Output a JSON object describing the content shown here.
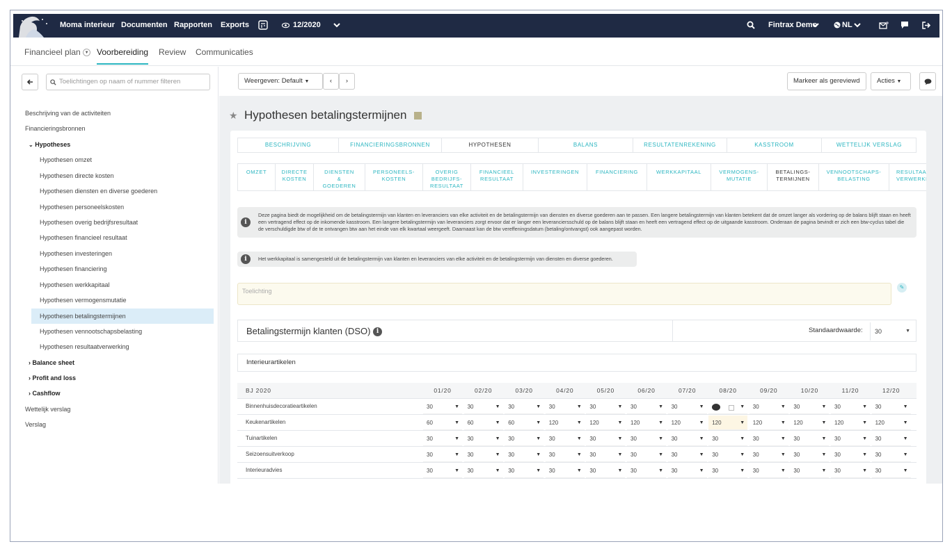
{
  "navbar": {
    "company": "Moma interieur",
    "documents": "Documenten",
    "reports": "Rapporten",
    "exports": "Exports",
    "period": "12/2020",
    "user": "Fintrax Demo",
    "language": "NL"
  },
  "subnav": {
    "tabs": [
      "Financieel plan",
      "Voorbereiding",
      "Review",
      "Communicaties"
    ]
  },
  "sidebar": {
    "filter_placeholder": "Toelichtingen op naam of nummer filteren",
    "items": [
      "Beschrijving van de activiteiten",
      "Financieringsbronnen",
      "Hypotheses",
      "Hypothesen omzet",
      "Hypothesen directe kosten",
      "Hypothesen diensten en diverse goederen",
      "Hypothesen personeelskosten",
      "Hypothesen overig bedrijfsresultaat",
      "Hypothesen financieel resultaat",
      "Hypothesen investeringen",
      "Hypothesen financiering",
      "Hypothesen werkkapitaal",
      "Hypothesen vermogensmutatie",
      "Hypothesen betalingstermijnen",
      "Hypothesen vennootschapsbelasting",
      "Hypothesen resultaatverwerking",
      "Balance sheet",
      "Profit and loss",
      "Cashflow",
      "Wettelijk verslag",
      "Verslag"
    ]
  },
  "toolbar": {
    "view": "Weergeven: Default",
    "mark_reviewed": "Markeer als gereviewd",
    "actions": "Acties"
  },
  "page": {
    "title": "Hypothesen betalingstermijnen",
    "main_tabs": [
      "BESCHRIJVING",
      "FINANCIERINGSBRONNEN",
      "HYPOTHESEN",
      "BALANS",
      "RESULTATENREKENING",
      "KASSTROOM",
      "WETTELIJK VERSLAG"
    ],
    "sub_tabs": [
      "OMZET",
      "DIRECTE\nKOSTEN",
      "DIENSTEN\n&\nGOEDEREN",
      "PERSONEELS-\nKOSTEN",
      "OVERIG\nBEDRIJFS-\nRESULTAAT",
      "FINANCIEEL\nRESULTAAT",
      "INVESTERINGEN",
      "FINANCIERING",
      "WERKKAPITAAL",
      "VERMOGENS-\nMUTATIE",
      "BETALINGS-\nTERMIJNEN",
      "VENNOOTSCHAPS-\nBELASTING",
      "RESULTAAT-\nVERWERKING"
    ],
    "info1": "Deze pagina biedt de mogelijkheid om de betalingstermijn van klanten en leveranciers van elke activiteit en de betalingstermijn van diensten en diverse goederen aan te passen. Een langere betalingstermijn van klanten betekent dat de omzet langer als vordering op de balans blijft staan en heeft een vertragend effect op de inkomende kasstroom. Een langere betalingstermijn van leveranciers zorgt ervoor dat er langer een leveranciersschuld op de balans blijft staan en heeft een vertragend effect op de uitgaande kasstroom. Onderaan de pagina bevindt er zich een btw-cyclus tabel die de verschuldigde btw of de te ontvangen btw aan het einde van elk kwartaal weergeeft. Daarnaast kan de btw vereffeningsdatum (betaling/ontvangst) ook aangepast worden.",
    "info2": "Het werkkapitaal is samengesteld uit de betalingstermijn van klanten en leveranciers van elke activiteit en de betalingstermijn van diensten en diverse goederen.",
    "note_placeholder": "Toelichting",
    "dso_title": "Betalingstermijn klanten (DSO)",
    "std_label": "Standaardwaarde:",
    "std_value": "30",
    "section": "Interieurartikelen",
    "year": "BJ 2020",
    "months": [
      "01/20",
      "02/20",
      "03/20",
      "04/20",
      "05/20",
      "06/20",
      "07/20",
      "08/20",
      "09/20",
      "10/20",
      "11/20",
      "12/20"
    ],
    "rows": [
      {
        "label": "Binnenhuisdecoratieartikelen",
        "values": [
          "30",
          "30",
          "30",
          "30",
          "30",
          "30",
          "30",
          "",
          "30",
          "30",
          "30",
          "30"
        ]
      },
      {
        "label": "Keukenartikelen",
        "values": [
          "60",
          "60",
          "60",
          "120",
          "120",
          "120",
          "120",
          "120",
          "120",
          "120",
          "120",
          "120"
        ]
      },
      {
        "label": "Tuinartikelen",
        "values": [
          "30",
          "30",
          "30",
          "30",
          "30",
          "30",
          "30",
          "30",
          "30",
          "30",
          "30",
          "30"
        ]
      },
      {
        "label": "Seizoensuitverkoop",
        "values": [
          "30",
          "30",
          "30",
          "30",
          "30",
          "30",
          "30",
          "30",
          "30",
          "30",
          "30",
          "30"
        ]
      },
      {
        "label": "Interieuradvies",
        "values": [
          "30",
          "30",
          "30",
          "30",
          "30",
          "30",
          "30",
          "30",
          "30",
          "30",
          "30",
          "30"
        ]
      }
    ]
  }
}
